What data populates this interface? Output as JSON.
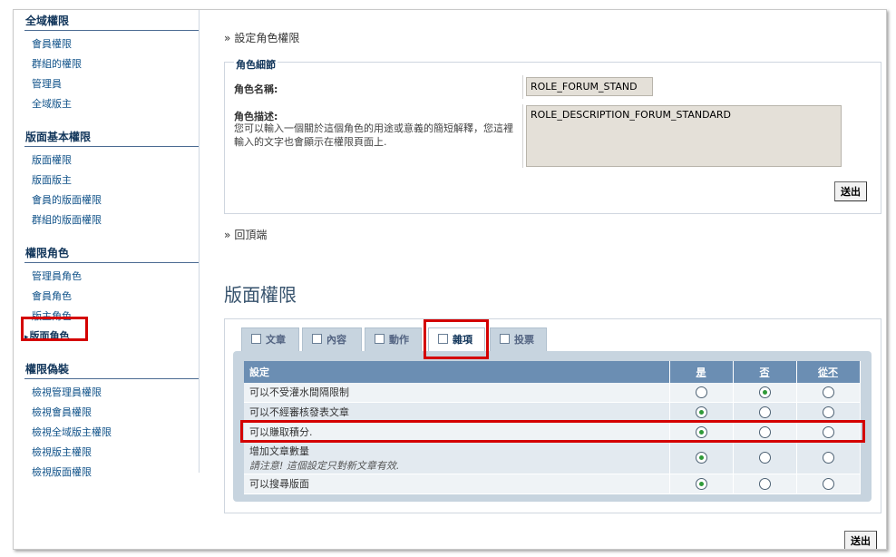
{
  "sidebar": {
    "groups": [
      {
        "heading": "全域權限",
        "items": [
          "會員權限",
          "群組的權限",
          "管理員",
          "全域版主"
        ]
      },
      {
        "heading": "版面基本權限",
        "items": [
          "版面權限",
          "版面版主",
          "會員的版面權限",
          "群組的版面權限"
        ]
      },
      {
        "heading": "權限角色",
        "items": [
          "管理員角色",
          "會員角色",
          "版主角色",
          "版面角色"
        ]
      },
      {
        "heading": "權限偽裝",
        "items": [
          "檢視管理員權限",
          "檢視會員權限",
          "檢視全域版主權限",
          "檢視版主權限",
          "檢視版面權限"
        ]
      }
    ]
  },
  "breadcrumb": "設定角色權限",
  "raquo": "»",
  "role_details": {
    "legend": "角色細節",
    "name_label": "角色名稱:",
    "name_value": "ROLE_FORUM_STAND",
    "desc_label": "角色描述:",
    "desc_hint": "您可以輸入一個關於這個角色的用途或意義的簡短解釋，您這裡輸入的文字也會顯示在權限頁面上.",
    "desc_value": "ROLE_DESCRIPTION_FORUM_STANDARD",
    "submit": "送出"
  },
  "back_to_top": "回頂端",
  "section_title": "版面權限",
  "tabs": [
    "文章",
    "內容",
    "動作",
    "雜項",
    "投票"
  ],
  "active_tab": 3,
  "table": {
    "headers": [
      "設定",
      "是",
      "否",
      "從不"
    ],
    "rows": [
      {
        "label": "可以不受灌水間隔限制",
        "note": "",
        "selected": 1
      },
      {
        "label": "可以不經審核發表文章",
        "note": "",
        "selected": 0
      },
      {
        "label": "可以賺取積分.",
        "note": "",
        "selected": 0
      },
      {
        "label": "增加文章數量",
        "note": "請注意! 這個設定只對新文章有效.",
        "selected": 0
      },
      {
        "label": "可以搜尋版面",
        "note": "",
        "selected": 0
      }
    ]
  },
  "bottom_submit": "送出"
}
